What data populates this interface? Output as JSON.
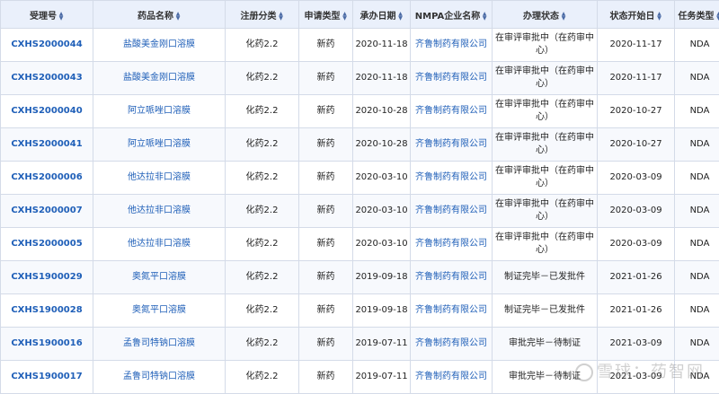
{
  "headers": [
    "受理号",
    "药品名称",
    "注册分类",
    "申请类型",
    "承办日期",
    "NMPA企业名称",
    "办理状态",
    "状态开始日",
    "任务类型"
  ],
  "rows": [
    [
      "CXHS2000044",
      "盐酸美金刚口溶膜",
      "化药2.2",
      "新药",
      "2020-11-18",
      "齐鲁制药有限公司",
      "在审评审批中（在药审中心）",
      "2020-11-17",
      "NDA"
    ],
    [
      "CXHS2000043",
      "盐酸美金刚口溶膜",
      "化药2.2",
      "新药",
      "2020-11-18",
      "齐鲁制药有限公司",
      "在审评审批中（在药审中心）",
      "2020-11-17",
      "NDA"
    ],
    [
      "CXHS2000040",
      "阿立哌唑口溶膜",
      "化药2.2",
      "新药",
      "2020-10-28",
      "齐鲁制药有限公司",
      "在审评审批中（在药审中心）",
      "2020-10-27",
      "NDA"
    ],
    [
      "CXHS2000041",
      "阿立哌唑口溶膜",
      "化药2.2",
      "新药",
      "2020-10-28",
      "齐鲁制药有限公司",
      "在审评审批中（在药审中心）",
      "2020-10-27",
      "NDA"
    ],
    [
      "CXHS2000006",
      "他达拉非口溶膜",
      "化药2.2",
      "新药",
      "2020-03-10",
      "齐鲁制药有限公司",
      "在审评审批中（在药审中心）",
      "2020-03-09",
      "NDA"
    ],
    [
      "CXHS2000007",
      "他达拉非口溶膜",
      "化药2.2",
      "新药",
      "2020-03-10",
      "齐鲁制药有限公司",
      "在审评审批中（在药审中心）",
      "2020-03-09",
      "NDA"
    ],
    [
      "CXHS2000005",
      "他达拉非口溶膜",
      "化药2.2",
      "新药",
      "2020-03-10",
      "齐鲁制药有限公司",
      "在审评审批中（在药审中心）",
      "2020-03-09",
      "NDA"
    ],
    [
      "CXHS1900029",
      "奥氮平口溶膜",
      "化药2.2",
      "新药",
      "2019-09-18",
      "齐鲁制药有限公司",
      "制证完毕－已发批件",
      "2021-01-26",
      "NDA"
    ],
    [
      "CXHS1900028",
      "奥氮平口溶膜",
      "化药2.2",
      "新药",
      "2019-09-18",
      "齐鲁制药有限公司",
      "制证完毕－已发批件",
      "2021-01-26",
      "NDA"
    ],
    [
      "CXHS1900016",
      "孟鲁司特钠口溶膜",
      "化药2.2",
      "新药",
      "2019-07-11",
      "齐鲁制药有限公司",
      "审批完毕－待制证",
      "2021-03-09",
      "NDA"
    ],
    [
      "CXHS1900017",
      "孟鲁司特钠口溶膜",
      "化药2.2",
      "新药",
      "2019-07-11",
      "齐鲁制药有限公司",
      "审批完毕－待制证",
      "2021-03-09",
      "NDA"
    ]
  ],
  "watermark": "雪球：药智网",
  "colors": {
    "header_bg": "#eaf0fb",
    "link": "#1f5fb8",
    "border": "#d4dbe8"
  }
}
